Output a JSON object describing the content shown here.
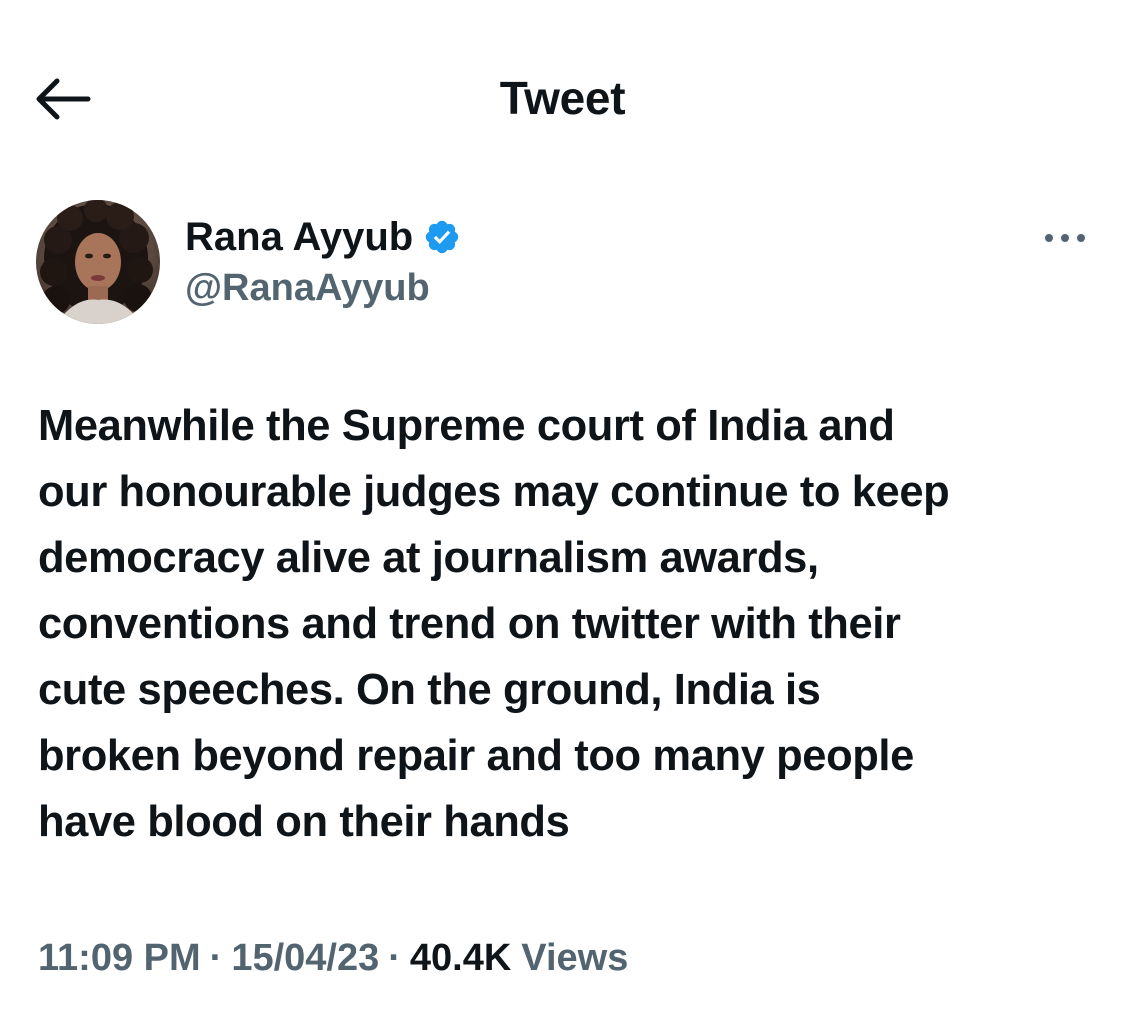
{
  "header": {
    "title": "Tweet",
    "back_icon": "arrow-left-icon"
  },
  "author": {
    "name": "Rana Ayyub",
    "handle": "@RanaAyyub",
    "verified": true,
    "verified_icon": "verified-badge-icon",
    "more_icon": "more-horizontal-icon"
  },
  "tweet": {
    "text": "Meanwhile the Supreme court of India and\nour honourable judges may continue to keep\ndemocracy alive at journalism awards,\nconventions and trend on twitter with their\ncute speeches. On the ground, India is\nbroken beyond repair and too many people\nhave blood on their hands",
    "time": "11:09 PM",
    "separator": "·",
    "date": "15/04/23",
    "views_count": "40.4K",
    "views_label": "Views"
  },
  "colors": {
    "text_primary": "#0f1419",
    "text_secondary": "#536471",
    "verified_blue": "#1d9bf0",
    "background": "#ffffff"
  }
}
